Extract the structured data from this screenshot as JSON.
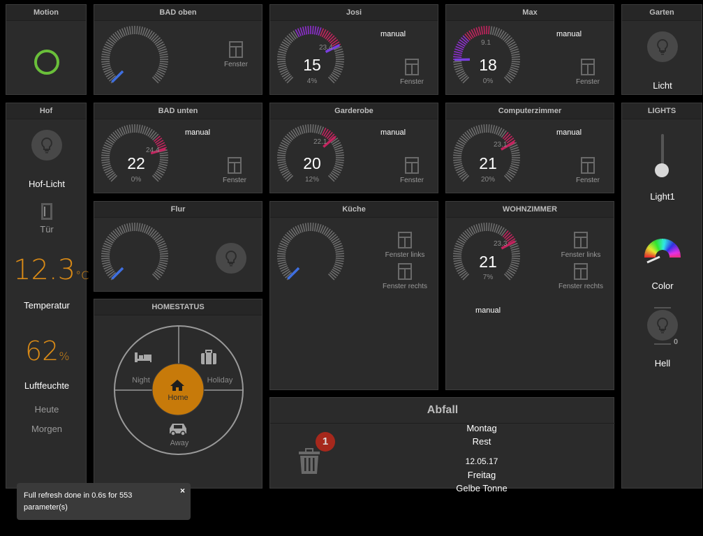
{
  "tiles": {
    "motion": {
      "title": "Motion"
    },
    "bad_oben": {
      "title": "BAD oben",
      "window_label": "Fenster"
    },
    "josi": {
      "title": "Josi",
      "temp": "15",
      "setpoint": "23.4",
      "valve": "4%",
      "mode": "manual",
      "window_label": "Fenster"
    },
    "max": {
      "title": "Max",
      "temp": "18",
      "setpoint": "9.1",
      "valve": "0%",
      "mode": "manual",
      "window_label": "Fenster"
    },
    "garten": {
      "title": "Garten",
      "label": "Licht"
    },
    "hof": {
      "title": "Hof",
      "light_label": "Hof-Licht",
      "door_label": "Tür",
      "temperature": "12.3",
      "temperature_unit": "°C",
      "temperature_label": "Temperatur",
      "humidity": "62",
      "humidity_unit": "%",
      "humidity_label": "Luftfeuchte",
      "today": "Heute",
      "tomorrow": "Morgen"
    },
    "bad_unten": {
      "title": "BAD unten",
      "temp": "22",
      "setpoint": "24.4",
      "valve": "0%",
      "mode": "manual",
      "window_label": "Fenster"
    },
    "garderobe": {
      "title": "Garderobe",
      "temp": "20",
      "setpoint": "22.1",
      "valve": "12%",
      "mode": "manual",
      "window_label": "Fenster"
    },
    "computerzimmer": {
      "title": "Computerzimmer",
      "temp": "21",
      "setpoint": "23.1",
      "valve": "20%",
      "mode": "manual",
      "window_label": "Fenster"
    },
    "lights": {
      "title": "LIGHTS",
      "light1_label": "Light1",
      "color_label": "Color",
      "hell_label": "Hell",
      "hell_value": "0"
    },
    "flur": {
      "title": "Flur"
    },
    "kueche": {
      "title": "Küche",
      "window1": "Fenster links",
      "window2": "Fenster rechts"
    },
    "wohnzimmer": {
      "title": "WOHNZIMMER",
      "temp": "21",
      "setpoint": "23.3",
      "valve": "7%",
      "mode": "manual",
      "window1": "Fenster links",
      "window2": "Fenster rechts"
    },
    "homestatus": {
      "title": "HOMESTATUS",
      "night": "Night",
      "holiday": "Holiday",
      "home": "Home",
      "away": "Away"
    },
    "abfall": {
      "title": "Abfall",
      "badge": "1",
      "day1": "Montag",
      "type1": "Rest",
      "date2": "12.05.17",
      "day2": "Freitag",
      "type2": "Gelbe Tonne"
    }
  },
  "toast": {
    "message": "Full refresh done in 0.6s for 553 parameter(s)",
    "close": "×"
  },
  "colors": {
    "accent_orange": "#d98a16",
    "motion_green": "#6abf3a",
    "cold_blue": "#3f6fe0",
    "warm_pink": "#c2245e",
    "purple": "#9b2fd0",
    "home_orange": "#c77a0a"
  }
}
